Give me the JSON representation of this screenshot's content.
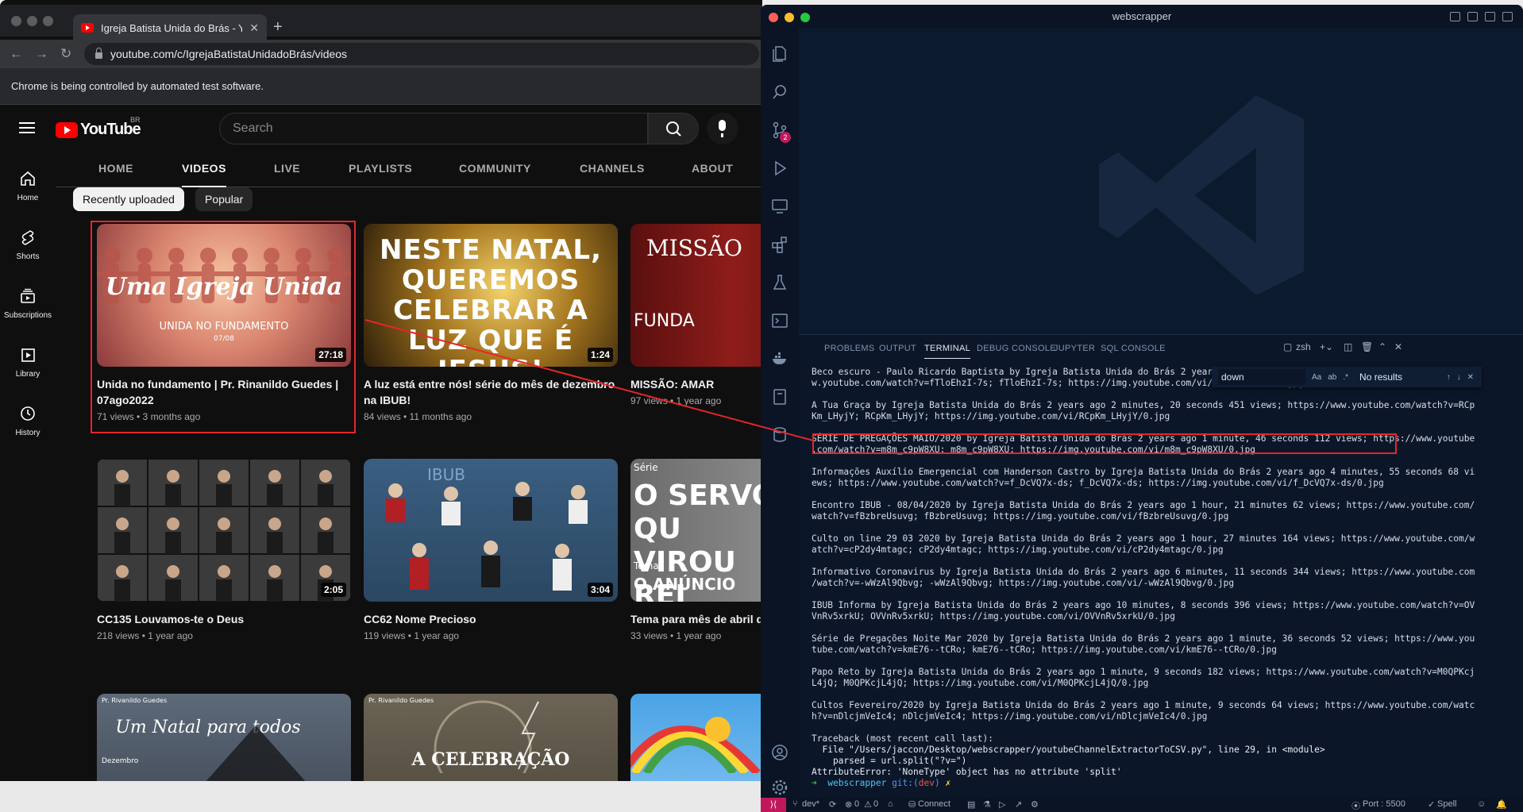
{
  "chrome": {
    "tab_title": "Igreja Batista Unida do Brás - Y",
    "url": "youtube.com/c/IgrejaBatistaUnidadoBrás/videos",
    "infobar": "Chrome is being controlled by automated test software."
  },
  "youtube": {
    "logo": "YouTube",
    "country": "BR",
    "search_placeholder": "Search",
    "rail": [
      {
        "label": "Home"
      },
      {
        "label": "Shorts"
      },
      {
        "label": "Subscriptions"
      },
      {
        "label": "Library"
      },
      {
        "label": "History"
      }
    ],
    "tabs": [
      "HOME",
      "VIDEOS",
      "LIVE",
      "PLAYLISTS",
      "COMMUNITY",
      "CHANNELS",
      "ABOUT"
    ],
    "chips": [
      "Recently uploaded",
      "Popular"
    ],
    "videos": [
      {
        "thumb_text": "Uma Igreja Unida",
        "thumb_sub": "UNIDA NO FUNDAMENTO",
        "thumb_sub2": "07/08",
        "duration": "27:18",
        "title": "Unida no fundamento | Pr. Rinanildo Guedes | 07ago2022",
        "meta": "71 views • 3 months ago"
      },
      {
        "thumb_text": "NESTE NATAL, QUEREMOS CELEBRAR A LUZ QUE É JESUS!",
        "duration": "1:24",
        "title": "A luz está entre nós! série do mês de dezembro na IBUB!",
        "meta": "84 views • 11 months ago"
      },
      {
        "thumb_text": "MISSÃO",
        "thumb_sub": "FUNDA",
        "duration": "",
        "title": "MISSÃO: AMAR",
        "meta": "97 views • 1 year ago"
      },
      {
        "duration": "2:05",
        "title": "CC135 Louvamos-te o Deus",
        "meta": "218 views • 1 year ago"
      },
      {
        "thumb_text": "IBUB",
        "duration": "3:04",
        "title": "CC62 Nome Precioso",
        "meta": "119 views • 1 year ago"
      },
      {
        "thumb_text": "O SERVO QU VIROU REI",
        "thumb_sub": "Série",
        "thumb_sub2": "Tema",
        "thumb_sub3": "O ANÚNCIO",
        "duration": "",
        "title": "Tema para mês de abril de virou Rei!\"",
        "meta": "33 views • 1 year ago"
      },
      {
        "thumb_text": "Um Natal para todos",
        "thumb_sub": "Pr. Rivanildo Guedes",
        "thumb_sub2": "Dezembro"
      },
      {
        "thumb_text": "A CELEBRAÇÃO",
        "thumb_sub": "Pr. Rivanildo Guedes"
      },
      {}
    ]
  },
  "vscode": {
    "title": "webscrapper",
    "scm_badge": "2",
    "panel_tabs": [
      "PROBLEMS",
      "OUTPUT",
      "TERMINAL",
      "DEBUG CONSOLE",
      "JUPYTER",
      "SQL CONSOLE"
    ],
    "shell": "zsh",
    "find": {
      "query": "down",
      "opt_case": "Aa",
      "opt_word": "ab",
      "opt_regex": ".*",
      "result": "No results"
    },
    "terminal_lines": [
      "Beco escuro - Paulo Ricardo Baptista by Igreja Batista Unida do Brás 2 years ag",
      "w.youtube.com/watch?v=fTloEhzI-7s; fTloEhzI-7s; https://img.youtube.com/vi/fTloEhzI-7s/0.jpg",
      "",
      "A Tua Graça by Igreja Batista Unida do Brás 2 years ago 2 minutes, 20 seconds 451 views; https://www.youtube.com/watch?v=RCp",
      "Km_LHyjY; RCpKm_LHyjY; https://img.youtube.com/vi/RCpKm_LHyjY/0.jpg",
      "",
      "SÉRIE DE PREGAÇÕES MAIO/2020 by Igreja Batista Unida do Brás 2 years ago 1 minute, 46 seconds 112 views; https://www.youtube",
      ".com/watch?v=m8m_c9pW8XU; m8m_c9pW8XU; https://img.youtube.com/vi/m8m_c9pW8XU/0.jpg",
      "",
      "Informações Auxílio Emergencial com Handerson Castro by Igreja Batista Unida do Brás 2 years ago 4 minutes, 55 seconds 68 vi",
      "ews; https://www.youtube.com/watch?v=f_DcVQ7x-ds; f_DcVQ7x-ds; https://img.youtube.com/vi/f_DcVQ7x-ds/0.jpg",
      "",
      "Encontro IBUB - 08/04/2020 by Igreja Batista Unida do Brás 2 years ago 1 hour, 21 minutes 62 views; https://www.youtube.com/",
      "watch?v=fBzbreUsuvg; fBzbreUsuvg; https://img.youtube.com/vi/fBzbreUsuvg/0.jpg",
      "",
      "Culto on line 29 03 2020 by Igreja Batista Unida do Brás 2 years ago 1 hour, 27 minutes 164 views; https://www.youtube.com/w",
      "atch?v=cP2dy4mtagc; cP2dy4mtagc; https://img.youtube.com/vi/cP2dy4mtagc/0.jpg",
      "",
      "Informativo Coronavirus by Igreja Batista Unida do Brás 2 years ago 6 minutes, 11 seconds 344 views; https://www.youtube.com",
      "/watch?v=-wWzAl9Qbvg; -wWzAl9Qbvg; https://img.youtube.com/vi/-wWzAl9Qbvg/0.jpg",
      "",
      "IBUB Informa by Igreja Batista Unida do Brás 2 years ago 10 minutes, 8 seconds 396 views; https://www.youtube.com/watch?v=OV",
      "VnRv5xrkU; OVVnRv5xrkU; https://img.youtube.com/vi/OVVnRv5xrkU/0.jpg",
      "",
      "Série de Pregações Noite Mar 2020 by Igreja Batista Unida do Brás 2 years ago 1 minute, 36 seconds 52 views; https://www.you",
      "tube.com/watch?v=kmE76--tCRo; kmE76--tCRo; https://img.youtube.com/vi/kmE76--tCRo/0.jpg",
      "",
      "Papo Reto by Igreja Batista Unida do Brás 2 years ago 1 minute, 9 seconds 182 views; https://www.youtube.com/watch?v=M0QPKcj",
      "L4jQ; M0QPKcjL4jQ; https://img.youtube.com/vi/M0QPKcjL4jQ/0.jpg",
      "",
      "Cultos Fevereiro/2020 by Igreja Batista Unida do Brás 2 years ago 1 minute, 9 seconds 64 views; https://www.youtube.com/watc",
      "h?v=nDlcjmVeIc4; nDlcjmVeIc4; https://img.youtube.com/vi/nDlcjmVeIc4/0.jpg",
      "",
      "Traceback (most recent call last):",
      "  File \"/Users/jaccon/Desktop/webscrapper/youtubeChannelExtractorToCSV.py\", line 29, in <module>",
      "    parsed = url.split(\"?v=\")",
      "AttributeError: 'NoneType' object has no attribute 'split'"
    ],
    "prompt": {
      "dir": "webscrapper",
      "git": "git:(",
      "branch": "dev",
      "git_close": ")",
      "mark": "✗"
    },
    "status": {
      "branch": "dev*",
      "errors": "0",
      "warnings": "0",
      "connect": "Connect",
      "port": "Port : 5500",
      "spell": "Spell"
    }
  },
  "colors": {
    "accent_red": "#e8252a",
    "yt_red": "#ff0000",
    "vscode_bg": "#0b1729"
  }
}
